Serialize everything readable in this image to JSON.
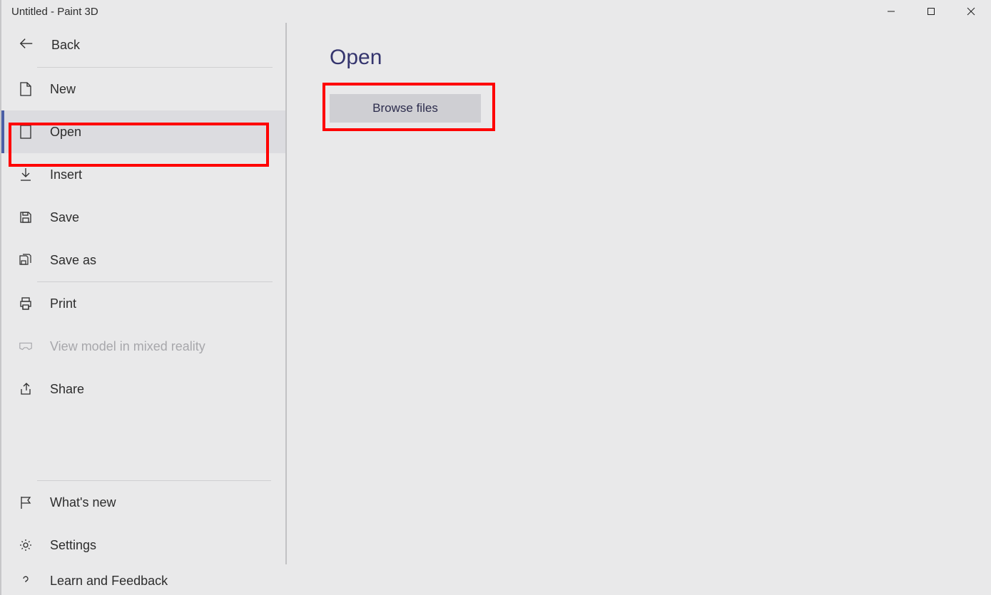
{
  "window": {
    "title": "Untitled - Paint 3D"
  },
  "sidebar": {
    "back": "Back",
    "items": [
      {
        "label": "New"
      },
      {
        "label": "Open"
      },
      {
        "label": "Insert"
      },
      {
        "label": "Save"
      },
      {
        "label": "Save as"
      },
      {
        "label": "Print"
      },
      {
        "label": "View model in mixed reality"
      },
      {
        "label": "Share"
      }
    ],
    "footer": [
      {
        "label": "What's new"
      },
      {
        "label": "Settings"
      },
      {
        "label": "Learn and Feedback"
      }
    ]
  },
  "content": {
    "title": "Open",
    "browse_button": "Browse files"
  }
}
